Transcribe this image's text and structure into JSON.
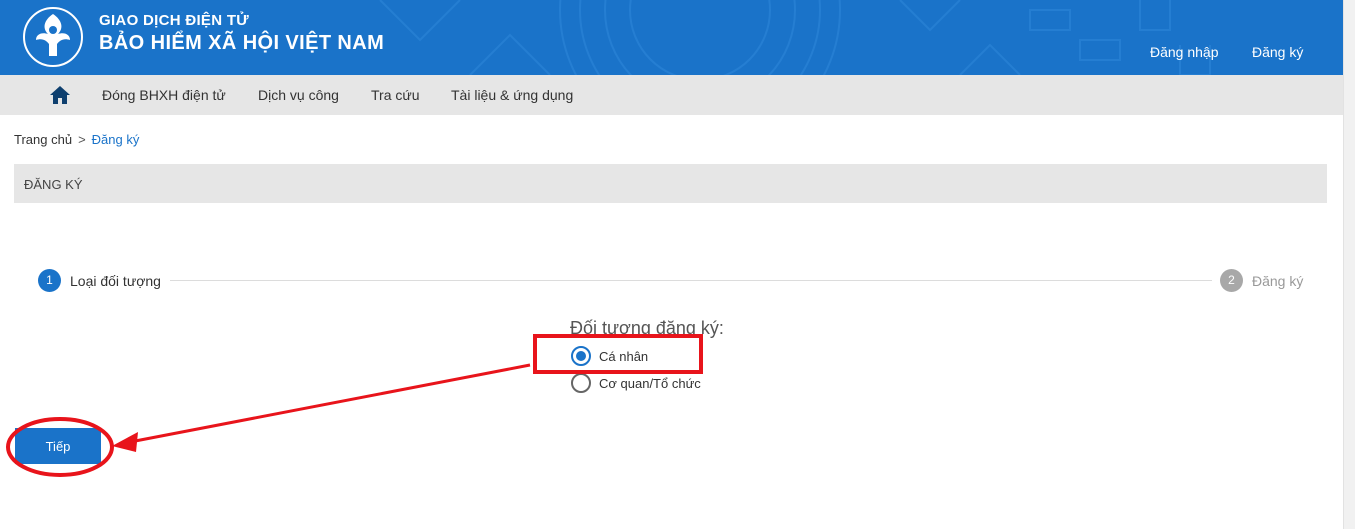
{
  "header": {
    "brand_line1": "GIAO DỊCH ĐIỆN TỬ",
    "brand_line2": "BẢO HIỂM XÃ HỘI VIỆT NAM",
    "login": "Đăng nhập",
    "register": "Đăng ký",
    "logo_icon": "bhxh-logo-icon",
    "color": "#1a73c9"
  },
  "nav": {
    "home_icon": "home-icon",
    "items": [
      {
        "label": "Đóng BHXH điện tử"
      },
      {
        "label": "Dịch vụ công"
      },
      {
        "label": "Tra cứu"
      },
      {
        "label": "Tài liệu & ứng dụng"
      }
    ]
  },
  "breadcrumb": {
    "home": "Trang chủ",
    "separator": ">",
    "current": "Đăng ký"
  },
  "page_title": "ĐĂNG KÝ",
  "stepper": {
    "steps": [
      {
        "number": "1",
        "label": "Loại đối tượng",
        "active": true
      },
      {
        "number": "2",
        "label": "Đăng ký",
        "active": false
      }
    ]
  },
  "form": {
    "label": "Đối tượng đăng ký:",
    "options": [
      {
        "label": "Cá nhân",
        "checked": true
      },
      {
        "label": "Cơ quan/Tổ chức",
        "checked": false
      }
    ]
  },
  "next_button": "Tiếp",
  "annotation_color": "#e8141b"
}
